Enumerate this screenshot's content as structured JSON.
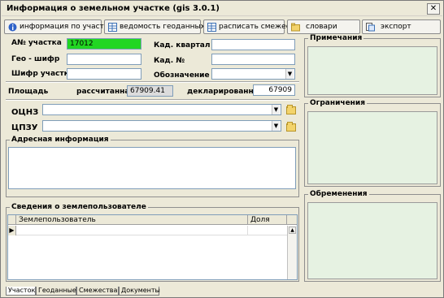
{
  "window": {
    "title": "Информация о земельном участке (gis 3.0.1)"
  },
  "toolbar": {
    "info_button": "информация по участку",
    "geodata_button": "ведомость геоданных",
    "neighbors_button": "расписать смежества",
    "dictionaries_button": "словари",
    "export_button": "экспорт"
  },
  "parcel": {
    "an_label": "А№ участка",
    "an_value": "17012",
    "geo_label": "Гео - шифр",
    "geo_value": "",
    "cipher_label": "Шифр участка",
    "cipher_value": "",
    "cad_quarter_label": "Кад. квартал",
    "cad_quarter_value": "",
    "cad_no_label": "Кад. №",
    "cad_no_value": "",
    "designation_label": "Обозначение",
    "designation_value": ""
  },
  "area": {
    "label": "Площадь",
    "calculated_label": "рассчитанная",
    "calculated_value": "67909.41",
    "declared_label": "декларированная",
    "declared_value": "67909"
  },
  "ocnz": {
    "label": "ОЦНЗ",
    "value": ""
  },
  "cpzu": {
    "label": "ЦПЗУ",
    "value": ""
  },
  "address": {
    "title": "Адресная информация",
    "value": ""
  },
  "landuser": {
    "title": "Сведения о землепользователе",
    "columns": [
      "Землепользователь",
      "Доля"
    ],
    "rows": [
      [
        "",
        ""
      ]
    ]
  },
  "notes": {
    "title": "Примечания"
  },
  "restrictions": {
    "title": "Ограничения"
  },
  "encumbrances": {
    "title": "Обременения"
  },
  "tabs": [
    "Участок",
    "Геоданные",
    "Смежества",
    "Документы"
  ]
}
